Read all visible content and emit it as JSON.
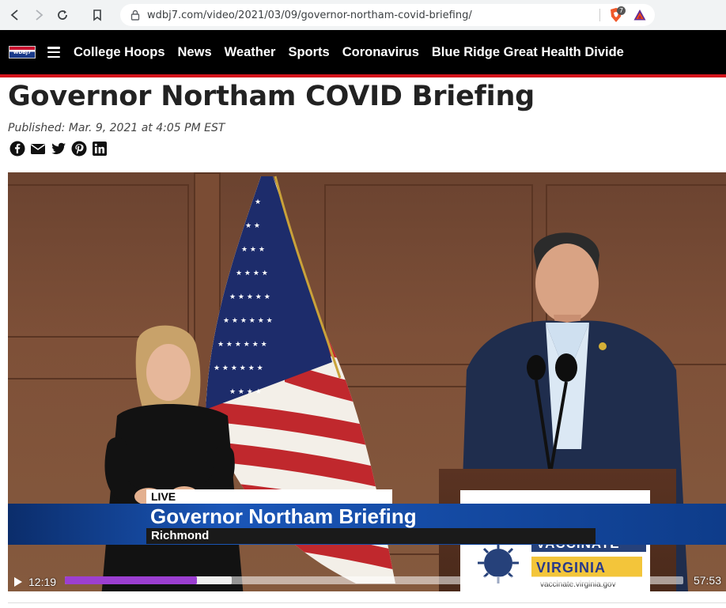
{
  "browser": {
    "url": "wdbj7.com/video/2021/03/09/governor-northam-covid-briefing/",
    "brave_badge": "7"
  },
  "header": {
    "logo_text": "WDBJ7",
    "nav": [
      "College Hoops",
      "News",
      "Weather",
      "Sports",
      "Coronavirus",
      "Blue Ridge Great Health Divide"
    ]
  },
  "article": {
    "title": "Governor Northam COVID Briefing",
    "published": "Published: Mar. 9, 2021 at 4:05 PM EST",
    "share_icons": [
      "facebook-icon",
      "email-icon",
      "twitter-icon",
      "pinterest-icon",
      "linkedin-icon"
    ]
  },
  "video": {
    "live_label": "LIVE",
    "headline": "Governor Northam Briefing",
    "location": "Richmond",
    "sign_line1": "VACCINATE",
    "sign_line2": "VIRGINIA",
    "sign_line3": "vaccinate.virginia.gov",
    "current_time": "12:19",
    "duration": "57:53",
    "progress_fraction": 0.213,
    "buffered_fraction": 0.27,
    "progress_color": "#9c3fd1"
  },
  "colors": {
    "header_bg": "#000000",
    "header_accent": "#d5121b"
  }
}
